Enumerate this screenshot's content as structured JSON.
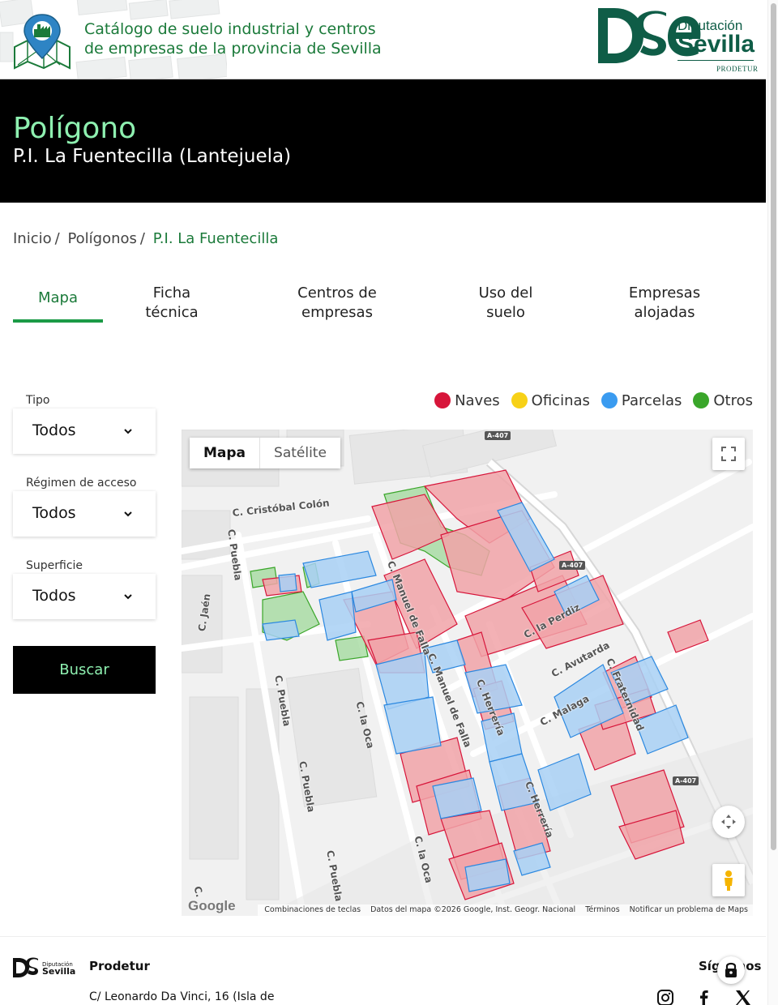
{
  "header": {
    "catalog_line1": "Catálogo de suelo industrial y centros",
    "catalog_line2": "de empresas de la provincia de Sevilla",
    "brand_line1": "Diputación",
    "brand_line2": "Sevilla",
    "brand_line3": "PRODETUR",
    "brand_color": "#0f5d47",
    "accent_color": "#1b7a3a"
  },
  "hero": {
    "kicker": "Polígono",
    "title": "P.I. La Fuentecilla (Lantejuela)"
  },
  "breadcrumb": {
    "items": [
      "Inicio",
      "Polígonos",
      "P.I. La Fuentecilla"
    ],
    "separator": "/"
  },
  "tabs": [
    {
      "line1": "Mapa",
      "line2": "",
      "active": true
    },
    {
      "line1": "Ficha",
      "line2": "técnica",
      "active": false
    },
    {
      "line1": "Centros de",
      "line2": "empresas",
      "active": false
    },
    {
      "line1": "Uso del",
      "line2": "suelo",
      "active": false
    },
    {
      "line1": "Empresas",
      "line2": "alojadas",
      "active": false
    }
  ],
  "filters": {
    "tipo": {
      "label": "Tipo",
      "value": "Todos"
    },
    "regimen": {
      "label": "Régimen de acceso",
      "value": "Todos"
    },
    "superficie": {
      "label": "Superficie",
      "value": "Todos"
    },
    "button": "Buscar"
  },
  "legend": [
    {
      "label": "Naves",
      "color": "#d7153a"
    },
    {
      "label": "Oficinas",
      "color": "#f7d117"
    },
    {
      "label": "Parcelas",
      "color": "#3a9bf0"
    },
    {
      "label": "Otros",
      "color": "#3aa62a"
    }
  ],
  "map": {
    "type_map": "Mapa",
    "type_satellite": "Satélite",
    "streets": [
      "C. Cristóbal Colón",
      "C. Puebla",
      "C. Jaén",
      "C. Puebla",
      "C. Puebla",
      "C. Puebla",
      "C. la Oca",
      "C. la Oca",
      "C. Manuel de Falla",
      "C. Manuel de Falla",
      "C. Herrería",
      "C. Herrería",
      "C. la Perdiz",
      "C. Avutarda",
      "C. Malaga",
      "C. Fraternidad",
      "C."
    ],
    "road_shields": [
      "A-407",
      "A-407",
      "A-407"
    ],
    "google": "Google",
    "attribution": [
      "Combinaciones de teclas",
      "Datos del mapa ©2026 Google, Inst. Geogr. Nacional",
      "Términos",
      "Notificar un problema de Maps"
    ],
    "colors": {
      "naves": "#d7153a",
      "parcelas": "#3a9bf0",
      "otros": "#3aa62a"
    }
  },
  "footer": {
    "brand1": "Diputación",
    "brand2": "Sevilla",
    "name": "Prodetur",
    "address": "C/ Leonardo Da Vinci, 16 (Isla de",
    "follow": "Síguenos",
    "social": [
      "instagram-icon",
      "facebook-icon",
      "x-icon"
    ]
  }
}
